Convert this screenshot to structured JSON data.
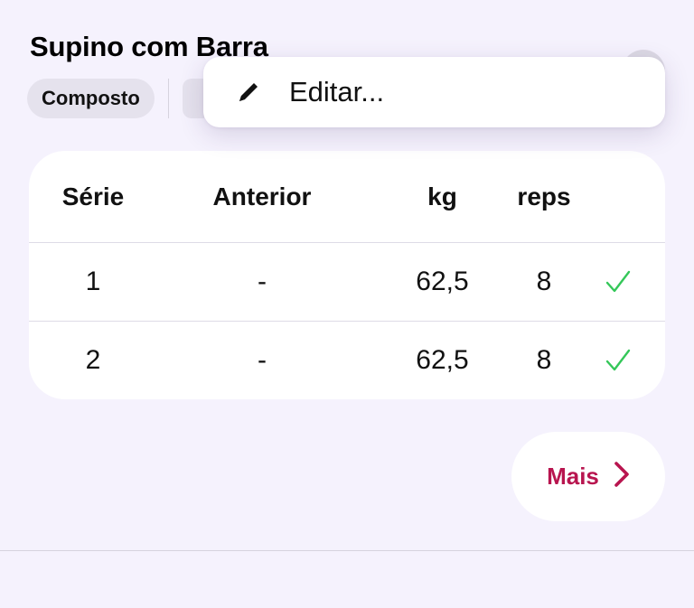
{
  "exercise": {
    "title": "Supino com Barra",
    "tag": "Composto"
  },
  "context_menu": {
    "edit_label": "Editar...",
    "edit_icon": "pencil-icon"
  },
  "table": {
    "headers": {
      "set": "Série",
      "previous": "Anterior",
      "weight": "kg",
      "reps": "reps"
    },
    "rows": [
      {
        "set": "1",
        "previous": "-",
        "weight": "62,5",
        "reps": "8",
        "done": true
      },
      {
        "set": "2",
        "previous": "-",
        "weight": "62,5",
        "reps": "8",
        "done": true
      }
    ]
  },
  "more_button": {
    "label": "Mais",
    "icon": "chevron-right-icon"
  },
  "colors": {
    "background": "#f5f2fd",
    "accent": "#b8154f",
    "check": "#34c759"
  }
}
